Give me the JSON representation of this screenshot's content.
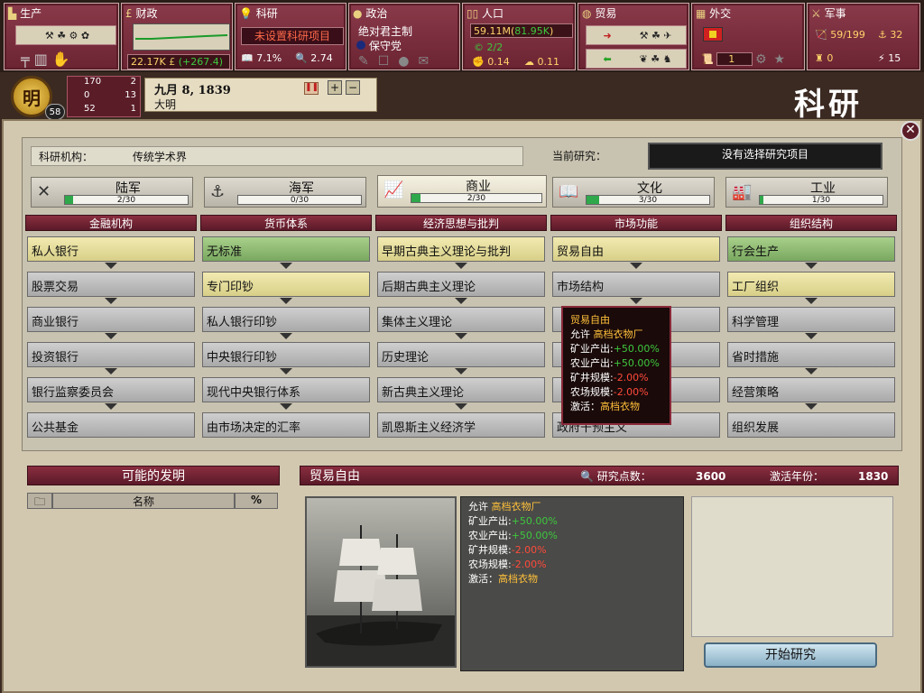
{
  "topbar": {
    "production": {
      "title": "生产"
    },
    "finance": {
      "title": "财政",
      "value": "22.17K",
      "delta": "(+267.4)"
    },
    "research": {
      "title": "科研",
      "status": "未设置科研项目",
      "literacy": "7.1%",
      "points": "2.74"
    },
    "politics": {
      "title": "政治",
      "government": "绝对君主制",
      "party": "保守党"
    },
    "population": {
      "title": "人口",
      "total": "59.11M(",
      "growth": "81.95K",
      "close": ")",
      "militancy": "2/2",
      "consciousness": "0.14",
      "other": "0.11"
    },
    "trade": {
      "title": "贸易"
    },
    "diplomacy": {
      "title": "外交",
      "value": "1"
    },
    "military": {
      "title": "军事",
      "army": "59/199",
      "navy": "32",
      "mob": "0",
      "leaders": "15"
    }
  },
  "nation": {
    "seal": "明",
    "rank": "58",
    "prestige": "170",
    "prestige_rank": "2",
    "industry": "0",
    "industry_rank": "13",
    "military": "52",
    "military_rank": "1",
    "date": "九月 8, 1839",
    "name": "大明"
  },
  "screen_title": "科研",
  "research": {
    "institution_label": "科研机构：",
    "institution": "传统学术界",
    "current_label": "当前研究：",
    "current": "没有选择研究项目",
    "tabs": [
      {
        "label": "陆军",
        "progress": "2/30",
        "pct": 0.067
      },
      {
        "label": "海军",
        "progress": "0/30",
        "pct": 0.0
      },
      {
        "label": "商业",
        "progress": "2/30",
        "pct": 0.067
      },
      {
        "label": "文化",
        "progress": "3/30",
        "pct": 0.1
      },
      {
        "label": "工业",
        "progress": "1/30",
        "pct": 0.033
      }
    ],
    "columns": [
      {
        "title": "金融机构",
        "items": [
          "私人银行",
          "股票交易",
          "商业银行",
          "投资银行",
          "银行监察委员会",
          "公共基金"
        ],
        "states": [
          "y",
          "n",
          "n",
          "n",
          "n",
          "n"
        ]
      },
      {
        "title": "货币体系",
        "items": [
          "无标准",
          "专门印钞",
          "私人银行印钞",
          "中央银行印钞",
          "现代中央银行体系",
          "由市场决定的汇率"
        ],
        "states": [
          "g",
          "y",
          "n",
          "n",
          "n",
          "n"
        ]
      },
      {
        "title": "经济思想与批判",
        "items": [
          "早期古典主义理论与批判",
          "后期古典主义理论",
          "集体主义理论",
          "历史理论",
          "新古典主义理论",
          "凯恩斯主义经济学"
        ],
        "states": [
          "y",
          "n",
          "n",
          "n",
          "n",
          "n"
        ]
      },
      {
        "title": "市场功能",
        "items": [
          "贸易自由",
          "市场结构",
          "",
          "",
          "",
          "政府干预主义"
        ],
        "states": [
          "y",
          "n",
          "n",
          "n",
          "n",
          "n"
        ]
      },
      {
        "title": "组织结构",
        "items": [
          "行会生产",
          "工厂组织",
          "科学管理",
          "省时措施",
          "经营策略",
          "组织发展"
        ],
        "states": [
          "g",
          "y",
          "n",
          "n",
          "n",
          "n"
        ]
      }
    ]
  },
  "tooltip": {
    "title": "贸易自由",
    "allow_label": "允许",
    "allow": "高档衣物厂",
    "lines": [
      {
        "k": "矿业产出:",
        "v": "+50.00%"
      },
      {
        "k": "农业产出:",
        "v": "+50.00%"
      },
      {
        "k": "矿井规模:",
        "v": "-2.00%"
      },
      {
        "k": "农场规模:",
        "v": "-2.00%"
      }
    ],
    "activate_label": "激活：",
    "activate": "高档衣物"
  },
  "inventions": {
    "title": "可能的发明",
    "col_name": "名称",
    "col_pct": "%"
  },
  "detail": {
    "name": "贸易自由",
    "cost_label": "研究点数：",
    "cost": "3600",
    "year_label": "激活年份：",
    "year": "1830",
    "allow_label": "允许",
    "allow": "高档衣物厂",
    "lines": [
      {
        "k": "矿业产出:",
        "v": "+50.00%"
      },
      {
        "k": "农业产出:",
        "v": "+50.00%"
      },
      {
        "k": "矿井规模:",
        "v": "-2.00%"
      },
      {
        "k": "农场规模:",
        "v": "-2.00%"
      }
    ],
    "activate_label": "激活：",
    "activate": "高档衣物",
    "start_button": "开始研究"
  },
  "colors": {
    "bar_green": "#2ea84a",
    "positive": "#3ec83e",
    "negative": "#ff4a3a",
    "gold": "#ffc03a",
    "header": "#8a2e40"
  }
}
